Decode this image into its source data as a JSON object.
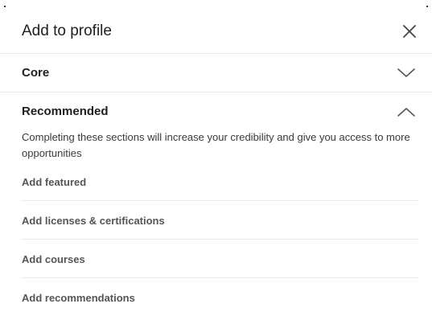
{
  "header": {
    "title": "Add to profile",
    "close_icon": "close-icon"
  },
  "sections": {
    "core": {
      "title": "Core",
      "state": "collapsed",
      "icon": "chevron-down-icon"
    },
    "recommended": {
      "title": "Recommended",
      "state": "expanded",
      "icon": "chevron-up-icon",
      "description": "Completing these sections will increase your credibility and give you access to more opportunities",
      "items": [
        {
          "label": "Add featured"
        },
        {
          "label": "Add licenses & certifications"
        },
        {
          "label": "Add courses"
        },
        {
          "label": "Add recommendations"
        }
      ]
    }
  },
  "colors": {
    "text_primary": "#1f1f1f",
    "text_secondary": "#555555",
    "divider": "#e8e8e8"
  }
}
